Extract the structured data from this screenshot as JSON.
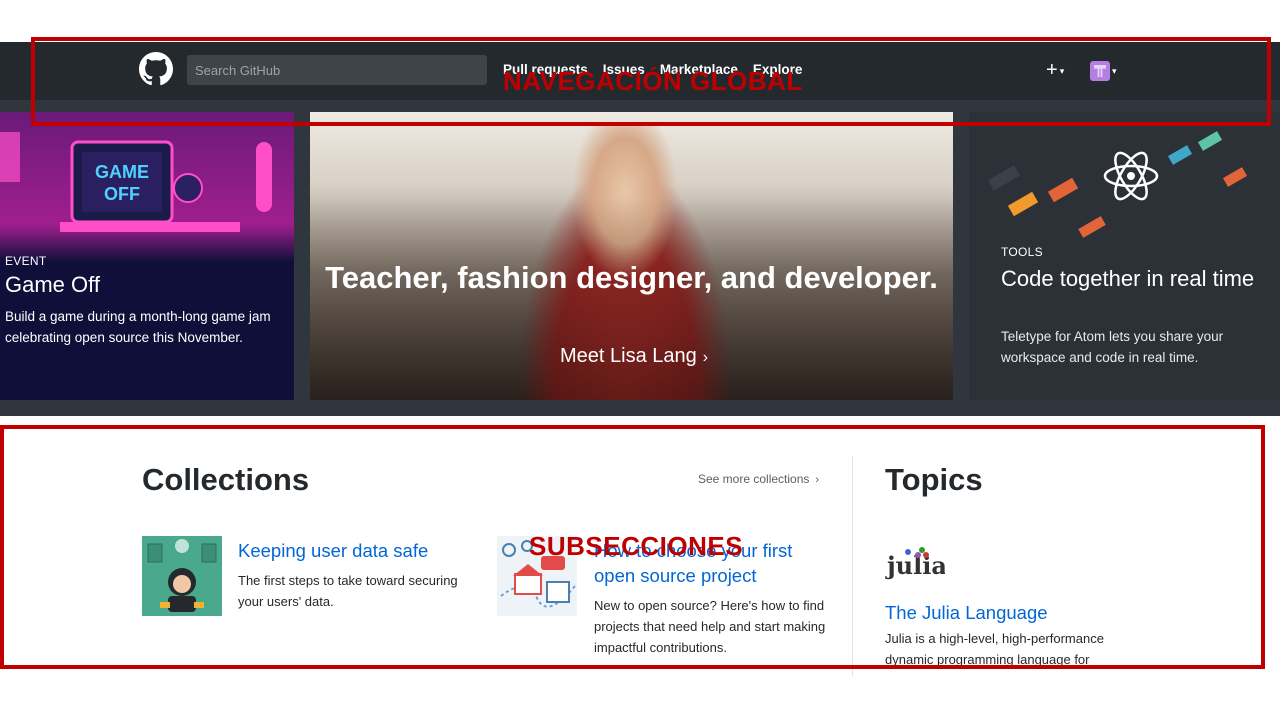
{
  "header": {
    "search_placeholder": "Search GitHub",
    "nav": [
      "Pull requests",
      "Issues",
      "Marketplace",
      "Explore"
    ],
    "plus_symbol": "+",
    "caret": "▾"
  },
  "hero": {
    "left": {
      "label": "EVENT",
      "title": "Game Off",
      "description": "Build a game during a month-long game jam celebrating open source this November."
    },
    "center": {
      "title": "Teacher, fashion designer, and developer.",
      "link": "Meet Lisa Lang",
      "chevron": "›"
    },
    "right": {
      "label": "TOOLS",
      "title": "Code together in real time",
      "description": "Teletype for Atom lets you share your workspace and code in real time."
    }
  },
  "collections": {
    "title": "Collections",
    "see_more": "See more collections",
    "chevron": "›",
    "items": [
      {
        "title": "Keeping user data safe",
        "description": "The first steps to take toward securing your users' data."
      },
      {
        "title": "How to choose your first open source project",
        "description": "New to open source? Here's how to find projects that need help and start making impactful contributions."
      }
    ]
  },
  "topics": {
    "title": "Topics",
    "logo_text": "julia",
    "items": [
      {
        "title": "The Julia Language",
        "description": "Julia is a high-level, high-performance dynamic programming language for"
      }
    ]
  },
  "annotations": {
    "nav_label": "NAVEGACIÓN GLOBAL",
    "sub_label": "SUBSECCIONES"
  },
  "colors": {
    "header_bg": "#24292e",
    "link_blue": "#0366d6",
    "annotation_red": "#c00000"
  }
}
